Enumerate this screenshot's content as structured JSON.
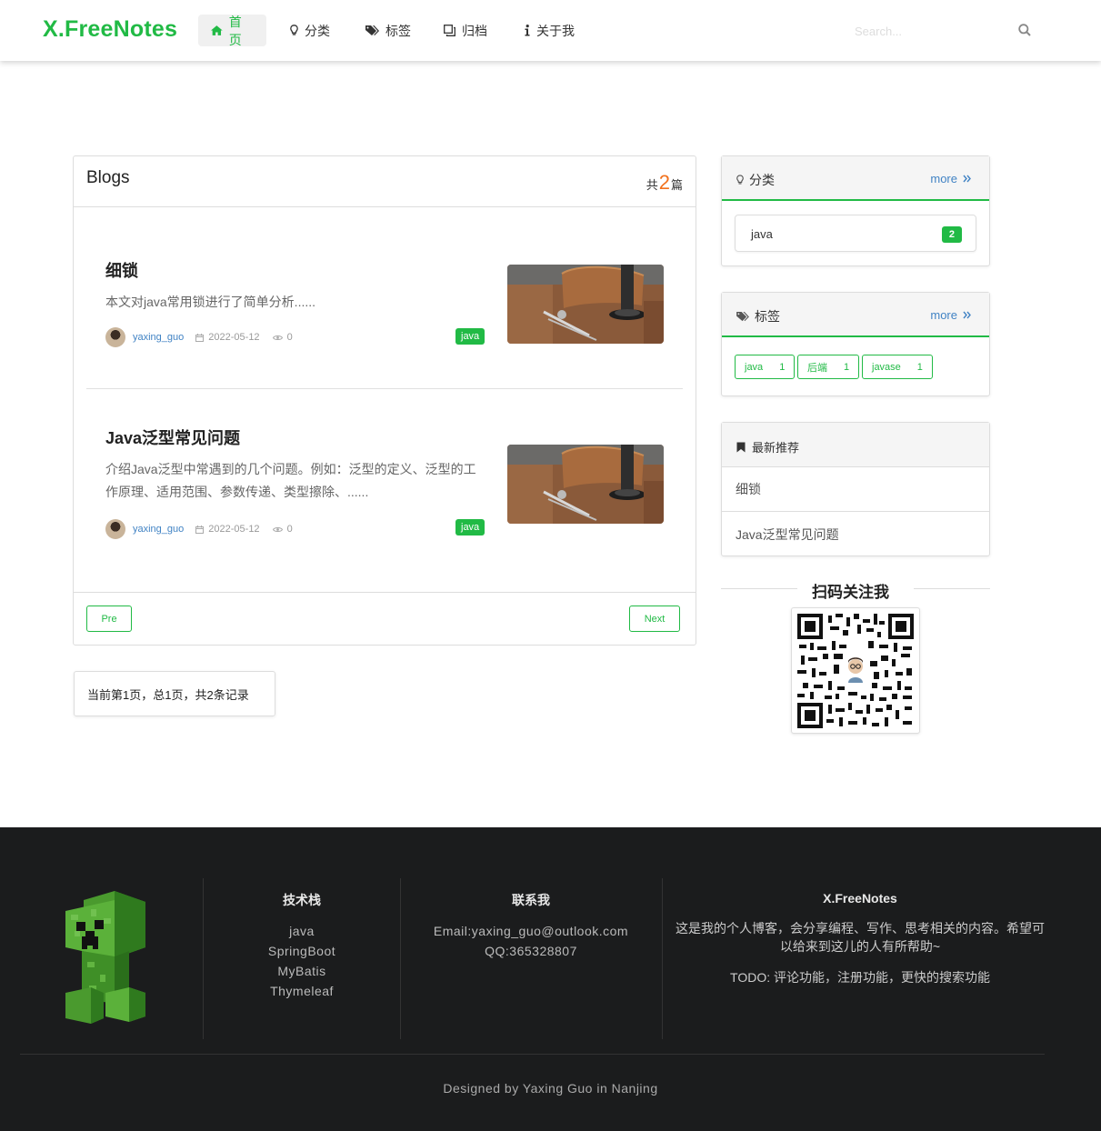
{
  "nav": {
    "logo": "X.FreeNotes",
    "items": [
      {
        "label": "首页",
        "icon": "home-icon",
        "active": true
      },
      {
        "label": "分类",
        "icon": "lightbulb-icon",
        "active": false
      },
      {
        "label": "标签",
        "icon": "tags-icon",
        "active": false
      },
      {
        "label": "归档",
        "icon": "clone-icon",
        "active": false
      },
      {
        "label": "关于我",
        "icon": "info-icon",
        "active": false
      }
    ],
    "search_placeholder": "Search..."
  },
  "blogs": {
    "title": "Blogs",
    "count_prefix": "共",
    "count": "2",
    "count_suffix": "篇",
    "posts": [
      {
        "title": "细锁",
        "excerpt": "本文对java常用锁进行了简单分析......",
        "author": "yaxing_guo",
        "date": "2022-05-12",
        "views": "0",
        "tag": "java"
      },
      {
        "title": "Java泛型常见问题",
        "excerpt": "介绍Java泛型中常遇到的几个问题。例如：泛型的定义、泛型的工作原理、适用范围、参数传递、类型擦除、......",
        "author": "yaxing_guo",
        "date": "2022-05-12",
        "views": "0",
        "tag": "java"
      }
    ],
    "prev_label": "Pre",
    "next_label": "Next",
    "page_info": "当前第1页，总1页，共2条记录"
  },
  "sidebar": {
    "categories": {
      "title": "分类",
      "more": "more",
      "items": [
        {
          "name": "java",
          "count": "2"
        }
      ]
    },
    "tags": {
      "title": "标签",
      "more": "more",
      "items": [
        {
          "name": "java",
          "count": "1"
        },
        {
          "name": "后端",
          "count": "1"
        },
        {
          "name": "javase",
          "count": "1"
        }
      ]
    },
    "recommend": {
      "title": "最新推荐",
      "items": [
        "细锁",
        "Java泛型常见问题"
      ]
    },
    "qr_title": "扫码关注我"
  },
  "footer": {
    "tech_title": "技术栈",
    "tech_items": [
      "java",
      "SpringBoot",
      "MyBatis",
      "Thymeleaf"
    ],
    "contact_title": "联系我",
    "contact_items": [
      "Email:yaxing_guo@outlook.com",
      "QQ:365328807"
    ],
    "about_title": "X.FreeNotes",
    "about_text": "这是我的个人博客，会分享编程、写作、思考相关的内容。希望可以给来到这儿的人有所帮助~",
    "todo_text": "TODO: 评论功能，注册功能，更快的搜索功能",
    "copyright": "Designed by Yaxing Guo in Nanjing"
  },
  "colors": {
    "brand": "#21ba45",
    "link": "#4183c4",
    "accent": "#f2711c",
    "footer_bg": "#1b1c1d"
  }
}
